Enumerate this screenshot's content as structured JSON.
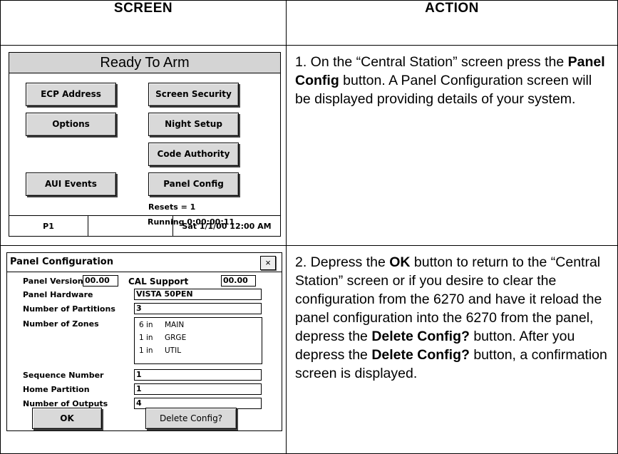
{
  "headers": {
    "screen": "SCREEN",
    "action": "ACTION"
  },
  "step1": {
    "screen": {
      "title": "Ready To Arm",
      "buttons": {
        "ecp_address": "ECP Address",
        "screen_security": "Screen Security",
        "options": "Options",
        "night_setup": "Night Setup",
        "code_authority": "Code Authority",
        "aui_events": "AUI Events",
        "panel_config": "Panel Config"
      },
      "resets": "Resets = 1",
      "running": "Running 0:00:00:11",
      "partition": "P1",
      "datetime": "Sat 1/1/00 12:00 AM"
    },
    "action": {
      "p1": "1.  On the “Central Station” screen press the ",
      "b1": "Panel Config",
      "p2": " button.  A Panel Configuration screen will be displayed providing details of your system."
    }
  },
  "step2": {
    "screen": {
      "title": "Panel Configuration",
      "close_glyph": "×",
      "panel_version_label": "Panel Version",
      "panel_version": "00.00",
      "cal_support_label": "CAL Support",
      "cal_support": "00.00",
      "panel_hardware_label": "Panel Hardware",
      "panel_hardware": "VISTA 50PEN",
      "num_partitions_label": "Number of Partitions",
      "num_partitions": "3",
      "num_zones_label": "Number of Zones",
      "zones": [
        {
          "count": "6 in",
          "name": "MAIN"
        },
        {
          "count": "1 in",
          "name": "GRGE"
        },
        {
          "count": "1 in",
          "name": "UTIL"
        }
      ],
      "sequence_number_label": "Sequence Number",
      "sequence_number": "1",
      "home_partition_label": "Home Partition",
      "home_partition": "1",
      "num_outputs_label": "Number of Outputs",
      "num_outputs": "4",
      "ok_button": "OK",
      "delete_button": "Delete Config?"
    },
    "action": {
      "p1": "2.  Depress the ",
      "b1": "OK",
      "p2": " button to return to the “Central Station” screen or if you desire to clear the configuration from the 6270 and have it reload the panel configuration into the 6270 from the panel, depress the ",
      "b2": "Delete Config?",
      "p3": " button. After you depress the ",
      "b3": "Delete Config?",
      "p4": " button, a confirmation screen is displayed."
    }
  }
}
